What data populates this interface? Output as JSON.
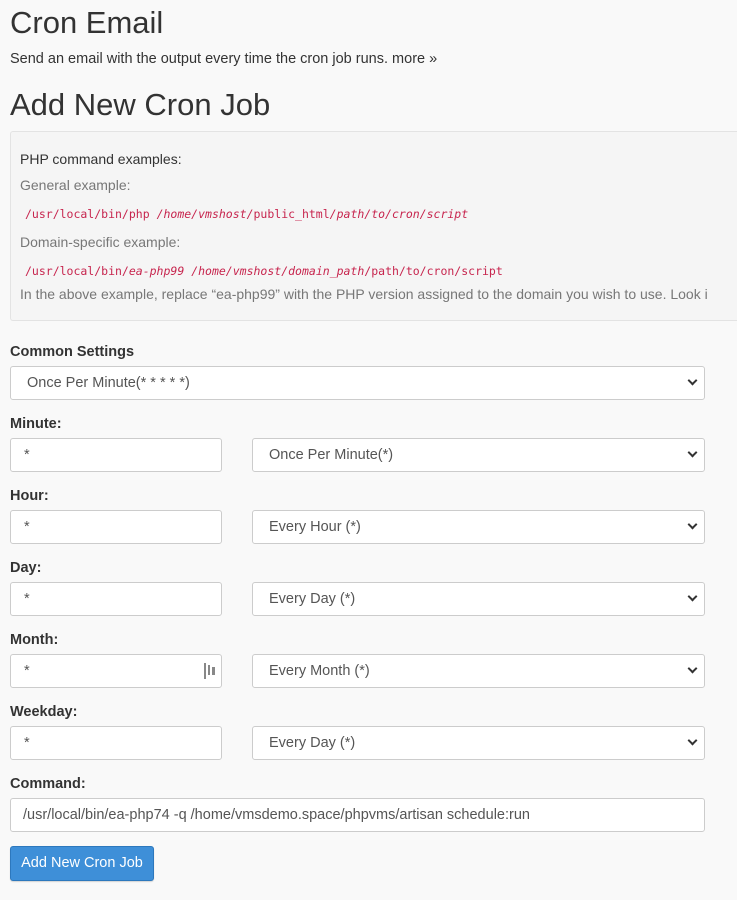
{
  "cron_email": {
    "title": "Cron Email",
    "description": "Send an email with the output every time the cron job runs.",
    "more_link": "more »"
  },
  "add_job": {
    "title": "Add New Cron Job",
    "examples": {
      "heading": "PHP command examples:",
      "general_label": "General example:",
      "general_code": [
        "/usr/local/bin/php",
        "/home/vmshost/",
        "public_html",
        "/path/to/cron/script"
      ],
      "domain_label": "Domain-specific example:",
      "domain_code": [
        "/usr/local/bin/",
        "ea-php99",
        "/home/vmshost/",
        "domain_path",
        "/path/to/cron/script"
      ],
      "note": "In the above example, replace “ea-php99” with the PHP version assigned to the domain you wish to use. Look i"
    },
    "common_settings": {
      "label": "Common Settings",
      "value": "Once Per Minute(* * * * *)"
    },
    "minute": {
      "label": "Minute:",
      "value": "*",
      "select": "Once Per Minute(*)"
    },
    "hour": {
      "label": "Hour:",
      "value": "*",
      "select": "Every Hour (*)"
    },
    "day": {
      "label": "Day:",
      "value": "*",
      "select": "Every Day (*)"
    },
    "month": {
      "label": "Month:",
      "value": "*",
      "select": "Every Month (*)"
    },
    "weekday": {
      "label": "Weekday:",
      "value": "*",
      "select": "Every Day (*)"
    },
    "command": {
      "label": "Command:",
      "value": "/usr/local/bin/ea-php74 -q /home/vmsdemo.space/phpvms/artisan schedule:run"
    },
    "submit_label": "Add New Cron Job"
  },
  "icons": {
    "select_arrow": "chevron-down-icon",
    "password_manager": "password-manager-icon"
  }
}
